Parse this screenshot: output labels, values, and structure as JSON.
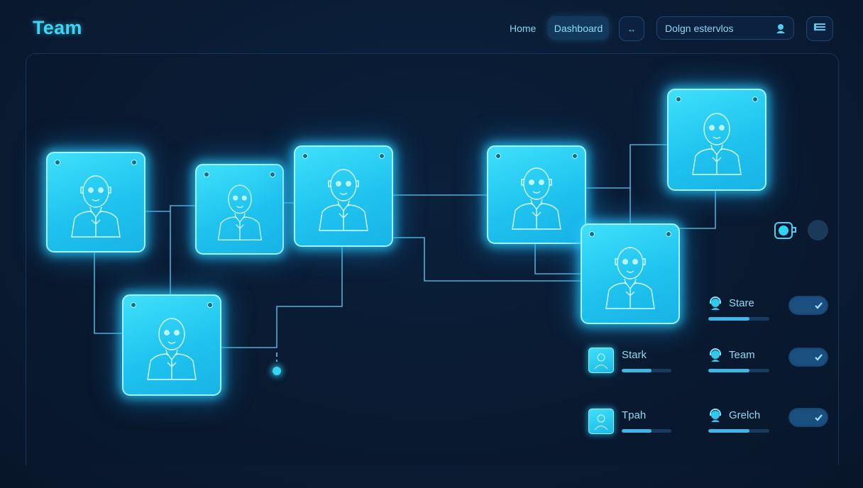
{
  "header": {
    "title": "Team",
    "nav": {
      "home": "Home",
      "dashboard": "Dashboard",
      "small_button": "↔"
    },
    "search": {
      "value": "Dolgn estervlos"
    }
  },
  "colors": {
    "background": "#0a1b33",
    "accent": "#3fd4f4",
    "card_fill": "#2ad0f5",
    "card_border": "#9ff3ff",
    "toggle_bg": "#1a4f80"
  },
  "team_cards": [
    {
      "icon": "person-avatar-icon"
    },
    {
      "icon": "person-avatar-icon"
    },
    {
      "icon": "person-avatar-icon"
    },
    {
      "icon": "person-avatar-icon"
    },
    {
      "icon": "person-avatar-icon"
    },
    {
      "icon": "person-avatar-icon"
    },
    {
      "icon": "person-avatar-icon"
    }
  ],
  "side_panel": {
    "right_rows": [
      {
        "label": "Stare",
        "progress": 0.68,
        "toggle": true
      },
      {
        "label": "Team",
        "progress": 0.68,
        "toggle": true
      },
      {
        "label": "Grelch",
        "progress": 0.68,
        "toggle": true
      }
    ],
    "left_rows": [
      {
        "label": "Stark",
        "progress": 0.6
      },
      {
        "label": "Tpah",
        "progress": 0.6
      }
    ]
  }
}
